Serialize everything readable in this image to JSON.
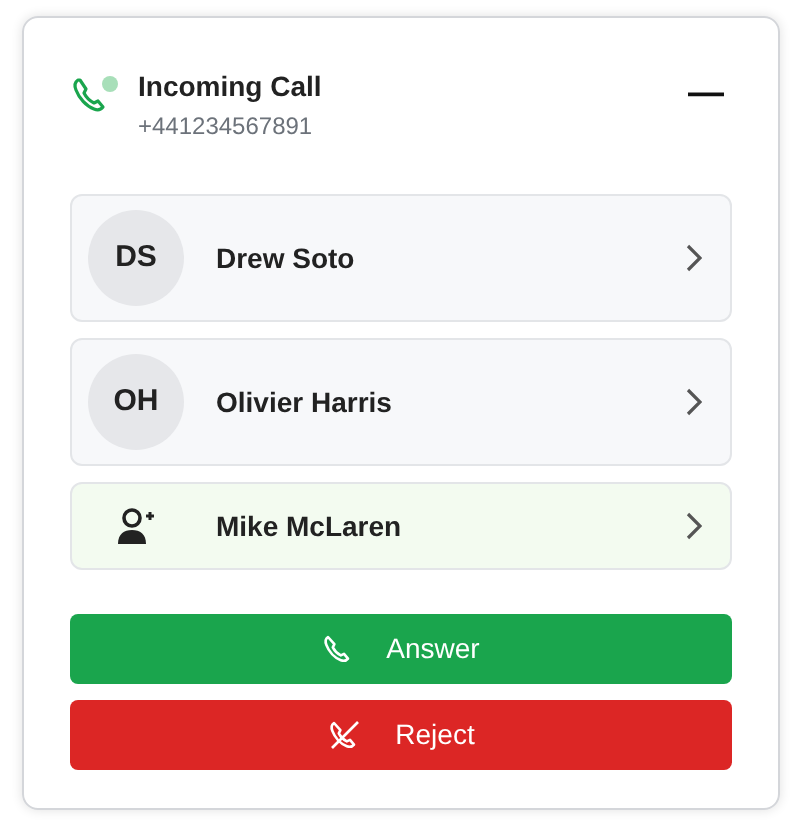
{
  "header": {
    "title": "Incoming Call",
    "number": "+441234567891",
    "minimize": "—"
  },
  "contacts": [
    {
      "kind": "initials",
      "initials": "DS",
      "name": "Drew Soto"
    },
    {
      "kind": "initials",
      "initials": "OH",
      "name": "Olivier Harris"
    },
    {
      "kind": "new",
      "name": "Mike McLaren"
    }
  ],
  "buttons": [
    {
      "kind": "answer",
      "label": "Answer"
    },
    {
      "kind": "reject",
      "label": "Reject"
    }
  ]
}
